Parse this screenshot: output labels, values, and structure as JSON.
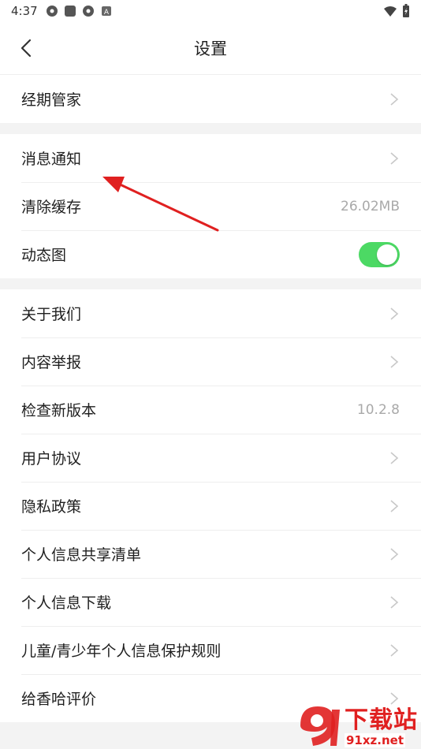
{
  "status_bar": {
    "time": "4:37",
    "icons": [
      "app-icon-1",
      "app-icon-2",
      "app-icon-3",
      "app-icon-a"
    ],
    "right_icons": [
      "wifi-icon",
      "battery-icon"
    ]
  },
  "header": {
    "title": "设置",
    "back_icon": "chevron-left-icon"
  },
  "groups": [
    {
      "rows": [
        {
          "label": "经期管家",
          "type": "chevron"
        }
      ]
    },
    {
      "rows": [
        {
          "label": "消息通知",
          "type": "chevron"
        },
        {
          "label": "清除缓存",
          "type": "value",
          "value": "26.02MB"
        },
        {
          "label": "动态图",
          "type": "toggle",
          "toggle_on": true
        }
      ]
    },
    {
      "rows": [
        {
          "label": "关于我们",
          "type": "chevron"
        },
        {
          "label": "内容举报",
          "type": "chevron"
        },
        {
          "label": "检查新版本",
          "type": "value",
          "value": "10.2.8"
        },
        {
          "label": "用户协议",
          "type": "chevron"
        },
        {
          "label": "隐私政策",
          "type": "chevron"
        },
        {
          "label": "个人信息共享清单",
          "type": "chevron"
        },
        {
          "label": "个人信息下载",
          "type": "chevron"
        },
        {
          "label": "儿童/青少年个人信息保护规则",
          "type": "chevron"
        },
        {
          "label": "给香哈评价",
          "type": "chevron"
        }
      ]
    }
  ],
  "watermark": {
    "main": "下载站",
    "sub": "91xz.net"
  },
  "colors": {
    "toggle_on": "#4cd964",
    "arrow": "#e02020",
    "background": "#f3f3f3"
  }
}
